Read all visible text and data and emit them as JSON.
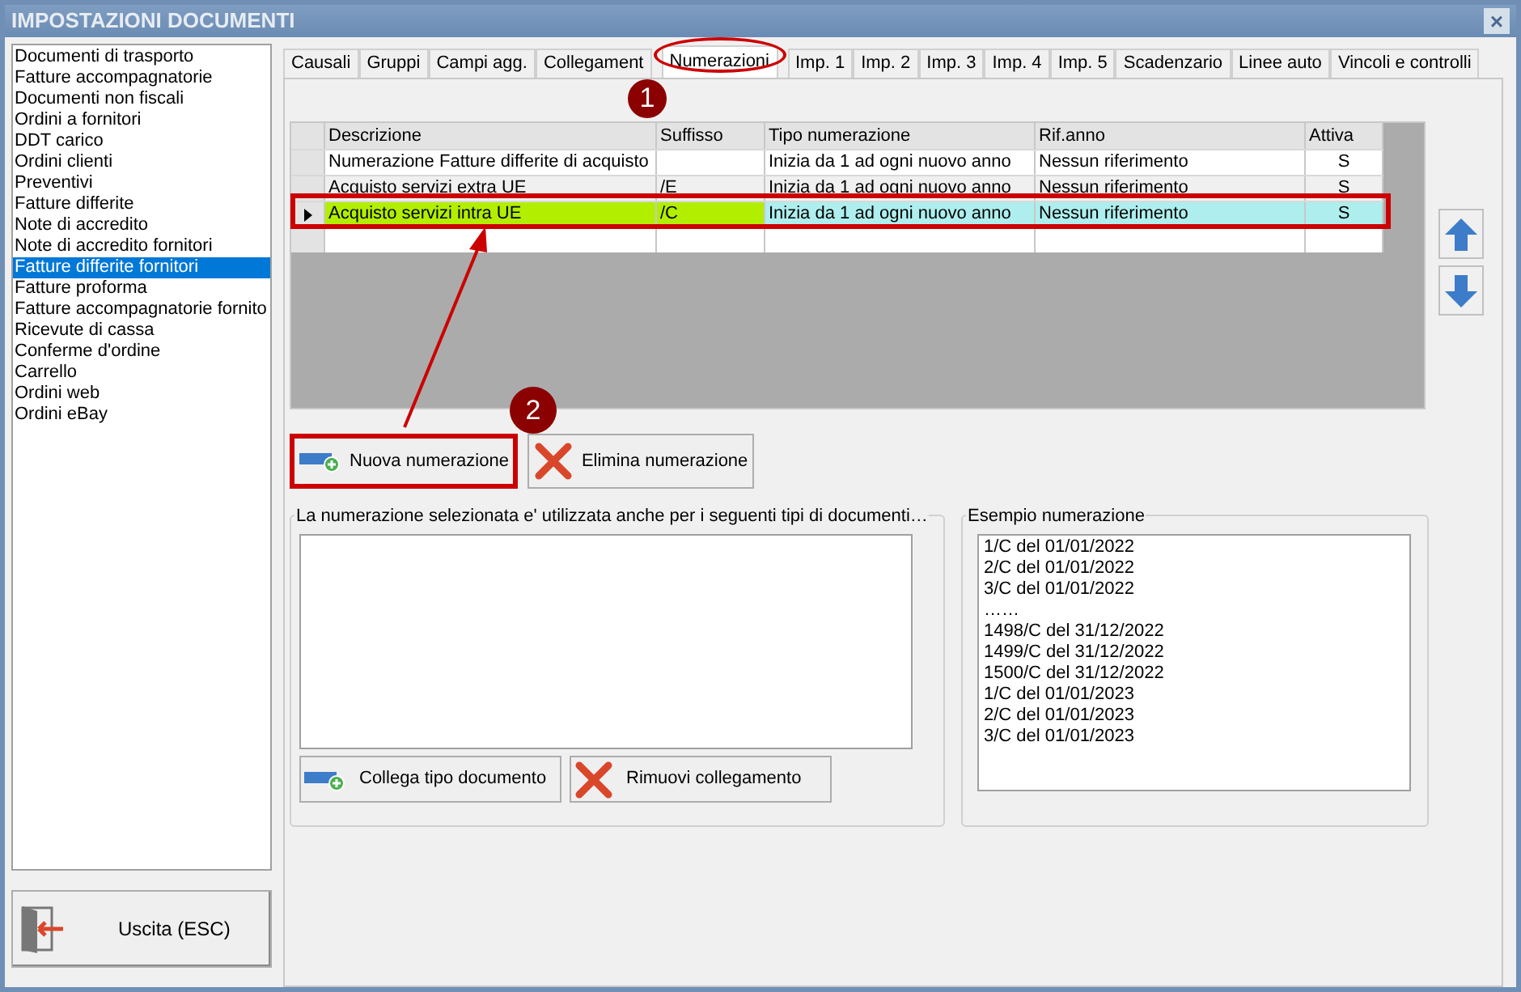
{
  "window": {
    "title": "IMPOSTAZIONI DOCUMENTI",
    "close": "×"
  },
  "sidebar": {
    "items": [
      {
        "label": "Documenti di trasporto",
        "selected": false
      },
      {
        "label": "Fatture accompagnatorie",
        "selected": false
      },
      {
        "label": "Documenti non fiscali",
        "selected": false
      },
      {
        "label": "Ordini a fornitori",
        "selected": false
      },
      {
        "label": "DDT carico",
        "selected": false
      },
      {
        "label": "Ordini clienti",
        "selected": false
      },
      {
        "label": "Preventivi",
        "selected": false
      },
      {
        "label": "Fatture differite",
        "selected": false
      },
      {
        "label": "Note di accredito",
        "selected": false
      },
      {
        "label": "Note di accredito fornitori",
        "selected": false
      },
      {
        "label": "Fatture differite fornitori",
        "selected": true
      },
      {
        "label": "Fatture proforma",
        "selected": false
      },
      {
        "label": "Fatture accompagnatorie fornito",
        "selected": false
      },
      {
        "label": "Ricevute di cassa",
        "selected": false
      },
      {
        "label": "Conferme d'ordine",
        "selected": false
      },
      {
        "label": "Carrello",
        "selected": false
      },
      {
        "label": "Ordini web",
        "selected": false
      },
      {
        "label": "Ordini eBay",
        "selected": false
      }
    ]
  },
  "exit_button": {
    "label": "Uscita (ESC)"
  },
  "tabs": [
    {
      "label": "Causali",
      "selected": false
    },
    {
      "label": "Gruppi",
      "selected": false
    },
    {
      "label": "Campi agg.",
      "selected": false
    },
    {
      "label": "Collegament",
      "selected": false
    },
    {
      "label": "Numerazioni",
      "selected": true
    },
    {
      "label": "Imp. 1",
      "selected": false
    },
    {
      "label": "Imp. 2",
      "selected": false
    },
    {
      "label": "Imp. 3",
      "selected": false
    },
    {
      "label": "Imp. 4",
      "selected": false
    },
    {
      "label": "Imp. 5",
      "selected": false
    },
    {
      "label": "Scadenzario",
      "selected": false
    },
    {
      "label": "Linee auto",
      "selected": false
    },
    {
      "label": "Vincoli e controlli",
      "selected": false
    }
  ],
  "table": {
    "columns": [
      "Descrizione",
      "Suffisso",
      "Tipo numerazione",
      "Rif.anno",
      "Attiva"
    ],
    "rows": [
      {
        "cells": [
          "Numerazione Fatture differite di acquisto",
          "",
          "Inizia da 1 ad ogni nuovo anno",
          "Nessun riferimento",
          "S"
        ],
        "selected": false
      },
      {
        "cells": [
          "Acquisto servizi extra UE",
          "/E",
          "Inizia da 1 ad ogni nuovo anno",
          "Nessun riferimento",
          "S"
        ],
        "selected": false
      },
      {
        "cells": [
          "Acquisto servizi intra UE",
          "/C",
          "Inizia da 1 ad ogni nuovo anno",
          "Nessun riferimento",
          "S"
        ],
        "selected": true
      }
    ]
  },
  "buttons": [
    {
      "label": "Nuova numerazione",
      "kind": "add"
    },
    {
      "label": "Elimina numerazione",
      "kind": "delete"
    }
  ],
  "linked_group": {
    "legend": "La numerazione selezionata e' utilizzata anche per i seguenti tipi di documenti…",
    "buttons": [
      {
        "label": "Collega tipo documento",
        "kind": "add"
      },
      {
        "label": "Rimuovi collegamento",
        "kind": "delete"
      }
    ]
  },
  "example_group": {
    "legend": "Esempio numerazione",
    "lines": [
      "1/C del 01/01/2022",
      "2/C del 01/01/2022",
      "3/C del 01/01/2022",
      "……",
      "1498/C del 31/12/2022",
      "1499/C del 31/12/2022",
      "1500/C del 31/12/2022",
      "1/C del 01/01/2023",
      "2/C del 01/01/2023",
      "3/C del 01/01/2023"
    ]
  },
  "annotations": [
    "1",
    "2"
  ]
}
